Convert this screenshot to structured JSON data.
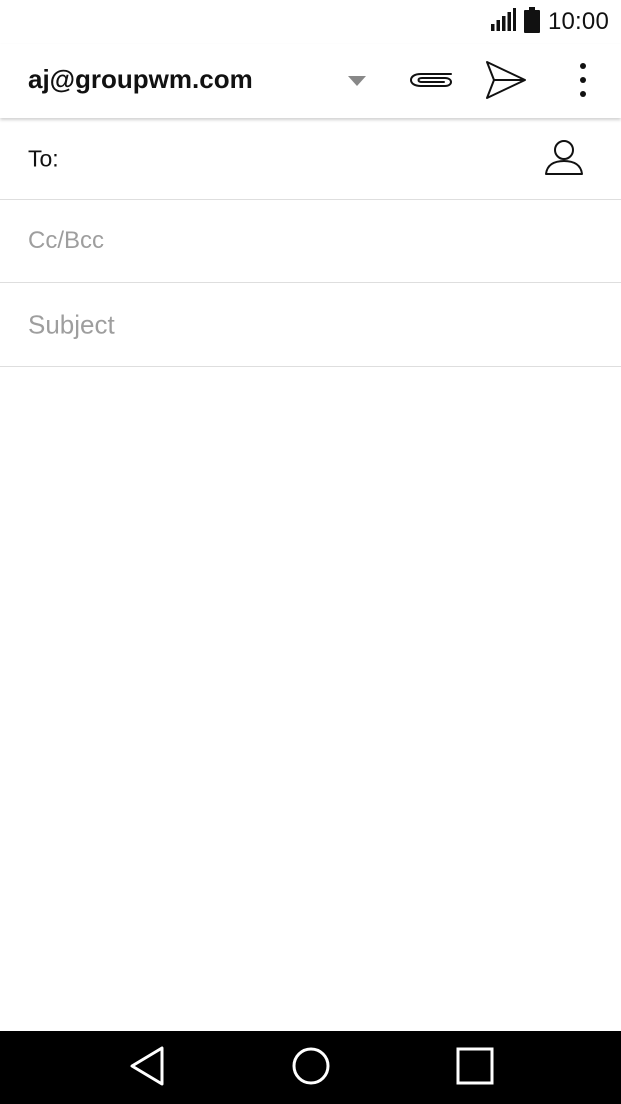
{
  "status_bar": {
    "time": "10:00",
    "icons": [
      "signal-icon",
      "battery-icon"
    ]
  },
  "compose": {
    "account": "aj@groupwm.com",
    "toolbar": {
      "dropdown_icon": "dropdown-arrow-icon",
      "attach_icon": "paperclip-icon",
      "send_icon": "send-icon",
      "more_icon": "more-vert-icon"
    },
    "to_label": "To:",
    "to_value": "",
    "contact_icon": "person-icon",
    "cc_placeholder": "Cc/Bcc",
    "subject_placeholder": "Subject",
    "body_value": ""
  },
  "nav_bar": {
    "icons": [
      "back-icon",
      "home-icon",
      "recents-icon"
    ]
  },
  "colors": {
    "background": "#ffffff",
    "text": "#111111",
    "placeholder": "#9e9e9e",
    "divider": "#dedede",
    "nav_bar": "#000000"
  }
}
